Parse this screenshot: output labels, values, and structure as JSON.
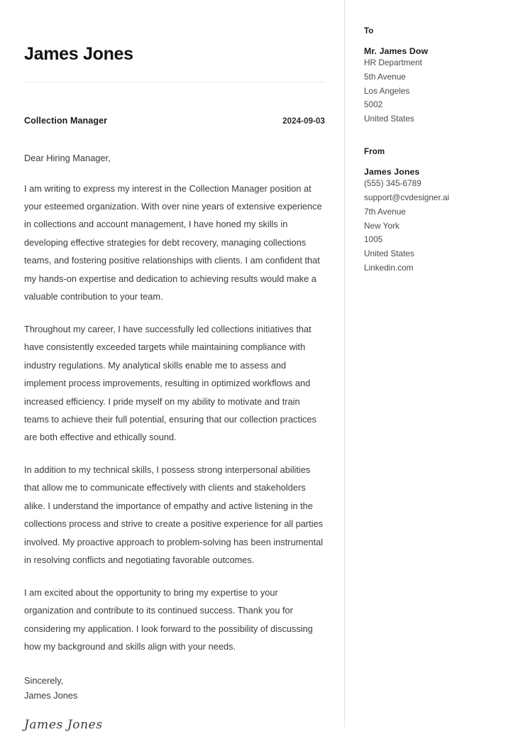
{
  "document": {
    "type": "cover-letter",
    "sender_name": "James Jones",
    "job_title": "Collection Manager",
    "date": "2024-09-03",
    "salutation": "Dear Hiring Manager,",
    "paragraphs": [
      "I am writing to express my interest in the Collection Manager position at your esteemed organization. With over nine years of extensive experience in collections and account management, I have honed my skills in developing effective strategies for debt recovery, managing collections teams, and fostering positive relationships with clients. I am confident that my hands-on expertise and dedication to achieving results would make a valuable contribution to your team.",
      "Throughout my career, I have successfully led collections initiatives that have consistently exceeded targets while maintaining compliance with industry regulations. My analytical skills enable me to assess and implement process improvements, resulting in optimized workflows and increased efficiency. I pride myself on my ability to motivate and train teams to achieve their full potential, ensuring that our collection practices are both effective and ethically sound.",
      "In addition to my technical skills, I possess strong interpersonal abilities that allow me to communicate effectively with clients and stakeholders alike. I understand the importance of empathy and active listening in the collections process and strive to create a positive experience for all parties involved. My proactive approach to problem-solving has been instrumental in resolving conflicts and negotiating favorable outcomes.",
      "I am excited about the opportunity to bring my expertise to your organization and contribute to its continued success. Thank you for considering my application. I look forward to the possibility of discussing how my background and skills align with your needs."
    ],
    "closing_phrase": "Sincerely,",
    "closing_name": "James Jones",
    "signature_text": "James Jones"
  },
  "sidebar": {
    "to": {
      "label": "To",
      "name": "Mr. James Dow",
      "lines": [
        "HR Department",
        "5th Avenue",
        "Los Angeles",
        "5002",
        "United States"
      ]
    },
    "from": {
      "label": "From",
      "name": "James Jones",
      "lines": [
        "(555) 345-6789",
        "support@cvdesigner.ai",
        "7th Avenue",
        "New York",
        "1005",
        "United States",
        "Linkedin.com"
      ]
    }
  },
  "colors": {
    "page_background": "#ffffff",
    "heading_text": "#121212",
    "body_text": "#3a3a3a",
    "muted_text": "#4a4a4a",
    "divider": "#e2e2e4",
    "rule": "#e8e8e8"
  }
}
